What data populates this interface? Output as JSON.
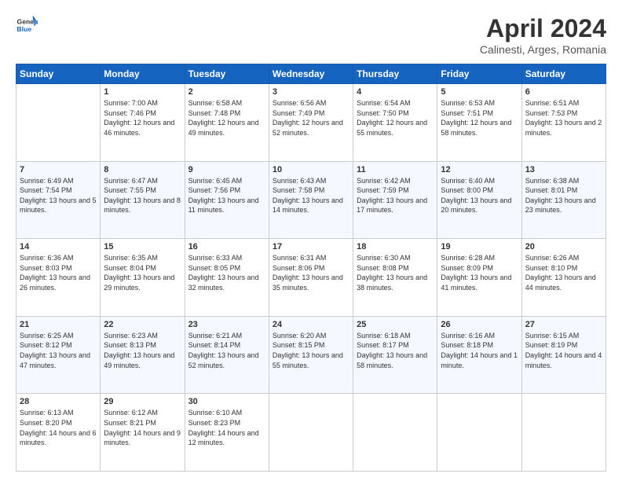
{
  "header": {
    "logo_general": "General",
    "logo_blue": "Blue",
    "title": "April 2024",
    "location": "Calinesti, Arges, Romania"
  },
  "days_of_week": [
    "Sunday",
    "Monday",
    "Tuesday",
    "Wednesday",
    "Thursday",
    "Friday",
    "Saturday"
  ],
  "weeks": [
    [
      {
        "day": "",
        "sunrise": "",
        "sunset": "",
        "daylight": ""
      },
      {
        "day": "1",
        "sunrise": "Sunrise: 7:00 AM",
        "sunset": "Sunset: 7:46 PM",
        "daylight": "Daylight: 12 hours and 46 minutes."
      },
      {
        "day": "2",
        "sunrise": "Sunrise: 6:58 AM",
        "sunset": "Sunset: 7:48 PM",
        "daylight": "Daylight: 12 hours and 49 minutes."
      },
      {
        "day": "3",
        "sunrise": "Sunrise: 6:56 AM",
        "sunset": "Sunset: 7:49 PM",
        "daylight": "Daylight: 12 hours and 52 minutes."
      },
      {
        "day": "4",
        "sunrise": "Sunrise: 6:54 AM",
        "sunset": "Sunset: 7:50 PM",
        "daylight": "Daylight: 12 hours and 55 minutes."
      },
      {
        "day": "5",
        "sunrise": "Sunrise: 6:53 AM",
        "sunset": "Sunset: 7:51 PM",
        "daylight": "Daylight: 12 hours and 58 minutes."
      },
      {
        "day": "6",
        "sunrise": "Sunrise: 6:51 AM",
        "sunset": "Sunset: 7:53 PM",
        "daylight": "Daylight: 13 hours and 2 minutes."
      }
    ],
    [
      {
        "day": "7",
        "sunrise": "Sunrise: 6:49 AM",
        "sunset": "Sunset: 7:54 PM",
        "daylight": "Daylight: 13 hours and 5 minutes."
      },
      {
        "day": "8",
        "sunrise": "Sunrise: 6:47 AM",
        "sunset": "Sunset: 7:55 PM",
        "daylight": "Daylight: 13 hours and 8 minutes."
      },
      {
        "day": "9",
        "sunrise": "Sunrise: 6:45 AM",
        "sunset": "Sunset: 7:56 PM",
        "daylight": "Daylight: 13 hours and 11 minutes."
      },
      {
        "day": "10",
        "sunrise": "Sunrise: 6:43 AM",
        "sunset": "Sunset: 7:58 PM",
        "daylight": "Daylight: 13 hours and 14 minutes."
      },
      {
        "day": "11",
        "sunrise": "Sunrise: 6:42 AM",
        "sunset": "Sunset: 7:59 PM",
        "daylight": "Daylight: 13 hours and 17 minutes."
      },
      {
        "day": "12",
        "sunrise": "Sunrise: 6:40 AM",
        "sunset": "Sunset: 8:00 PM",
        "daylight": "Daylight: 13 hours and 20 minutes."
      },
      {
        "day": "13",
        "sunrise": "Sunrise: 6:38 AM",
        "sunset": "Sunset: 8:01 PM",
        "daylight": "Daylight: 13 hours and 23 minutes."
      }
    ],
    [
      {
        "day": "14",
        "sunrise": "Sunrise: 6:36 AM",
        "sunset": "Sunset: 8:03 PM",
        "daylight": "Daylight: 13 hours and 26 minutes."
      },
      {
        "day": "15",
        "sunrise": "Sunrise: 6:35 AM",
        "sunset": "Sunset: 8:04 PM",
        "daylight": "Daylight: 13 hours and 29 minutes."
      },
      {
        "day": "16",
        "sunrise": "Sunrise: 6:33 AM",
        "sunset": "Sunset: 8:05 PM",
        "daylight": "Daylight: 13 hours and 32 minutes."
      },
      {
        "day": "17",
        "sunrise": "Sunrise: 6:31 AM",
        "sunset": "Sunset: 8:06 PM",
        "daylight": "Daylight: 13 hours and 35 minutes."
      },
      {
        "day": "18",
        "sunrise": "Sunrise: 6:30 AM",
        "sunset": "Sunset: 8:08 PM",
        "daylight": "Daylight: 13 hours and 38 minutes."
      },
      {
        "day": "19",
        "sunrise": "Sunrise: 6:28 AM",
        "sunset": "Sunset: 8:09 PM",
        "daylight": "Daylight: 13 hours and 41 minutes."
      },
      {
        "day": "20",
        "sunrise": "Sunrise: 6:26 AM",
        "sunset": "Sunset: 8:10 PM",
        "daylight": "Daylight: 13 hours and 44 minutes."
      }
    ],
    [
      {
        "day": "21",
        "sunrise": "Sunrise: 6:25 AM",
        "sunset": "Sunset: 8:12 PM",
        "daylight": "Daylight: 13 hours and 47 minutes."
      },
      {
        "day": "22",
        "sunrise": "Sunrise: 6:23 AM",
        "sunset": "Sunset: 8:13 PM",
        "daylight": "Daylight: 13 hours and 49 minutes."
      },
      {
        "day": "23",
        "sunrise": "Sunrise: 6:21 AM",
        "sunset": "Sunset: 8:14 PM",
        "daylight": "Daylight: 13 hours and 52 minutes."
      },
      {
        "day": "24",
        "sunrise": "Sunrise: 6:20 AM",
        "sunset": "Sunset: 8:15 PM",
        "daylight": "Daylight: 13 hours and 55 minutes."
      },
      {
        "day": "25",
        "sunrise": "Sunrise: 6:18 AM",
        "sunset": "Sunset: 8:17 PM",
        "daylight": "Daylight: 13 hours and 58 minutes."
      },
      {
        "day": "26",
        "sunrise": "Sunrise: 6:16 AM",
        "sunset": "Sunset: 8:18 PM",
        "daylight": "Daylight: 14 hours and 1 minute."
      },
      {
        "day": "27",
        "sunrise": "Sunrise: 6:15 AM",
        "sunset": "Sunset: 8:19 PM",
        "daylight": "Daylight: 14 hours and 4 minutes."
      }
    ],
    [
      {
        "day": "28",
        "sunrise": "Sunrise: 6:13 AM",
        "sunset": "Sunset: 8:20 PM",
        "daylight": "Daylight: 14 hours and 6 minutes."
      },
      {
        "day": "29",
        "sunrise": "Sunrise: 6:12 AM",
        "sunset": "Sunset: 8:21 PM",
        "daylight": "Daylight: 14 hours and 9 minutes."
      },
      {
        "day": "30",
        "sunrise": "Sunrise: 6:10 AM",
        "sunset": "Sunset: 8:23 PM",
        "daylight": "Daylight: 14 hours and 12 minutes."
      },
      {
        "day": "",
        "sunrise": "",
        "sunset": "",
        "daylight": ""
      },
      {
        "day": "",
        "sunrise": "",
        "sunset": "",
        "daylight": ""
      },
      {
        "day": "",
        "sunrise": "",
        "sunset": "",
        "daylight": ""
      },
      {
        "day": "",
        "sunrise": "",
        "sunset": "",
        "daylight": ""
      }
    ]
  ]
}
